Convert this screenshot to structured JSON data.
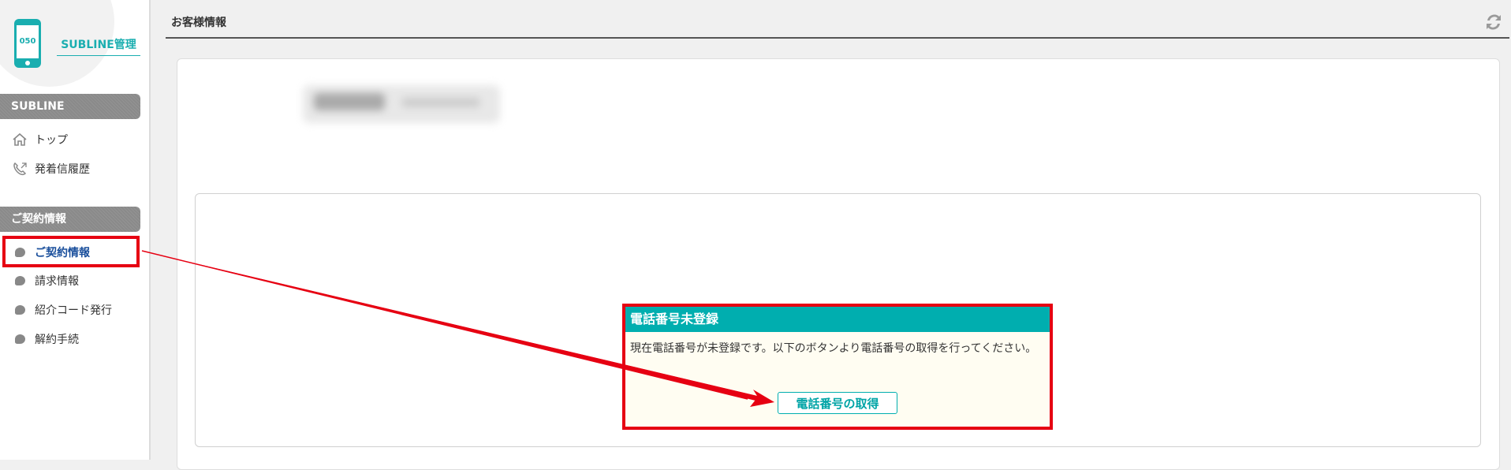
{
  "sidebar": {
    "phone_number_label": "050",
    "brand_title": "SUBLINE管理",
    "sections": [
      {
        "title": "SUBLINE"
      },
      {
        "title": "ご契約情報"
      }
    ],
    "items": [
      {
        "label": "トップ",
        "icon": "home-icon"
      },
      {
        "label": "発着信履歴",
        "icon": "phone-call-icon"
      },
      {
        "label": "ご契約情報",
        "icon": "bubble-icon",
        "active": true
      },
      {
        "label": "請求情報",
        "icon": "bubble-icon"
      },
      {
        "label": "紹介コード発行",
        "icon": "bubble-icon"
      },
      {
        "label": "解約手続",
        "icon": "bubble-icon"
      }
    ]
  },
  "header": {
    "title": "お客様情報",
    "refresh_icon": "refresh-icon"
  },
  "notice": {
    "title": "電話番号未登録",
    "message": "現在電話番号が未登録です。以下のボタンより電話番号の取得を行ってください。",
    "button_label": "電話番号の取得"
  },
  "colors": {
    "accent": "#00aeaf",
    "highlight": "#e60012",
    "active_link": "#1a4f9c",
    "section_header": "#8a8a8a"
  }
}
